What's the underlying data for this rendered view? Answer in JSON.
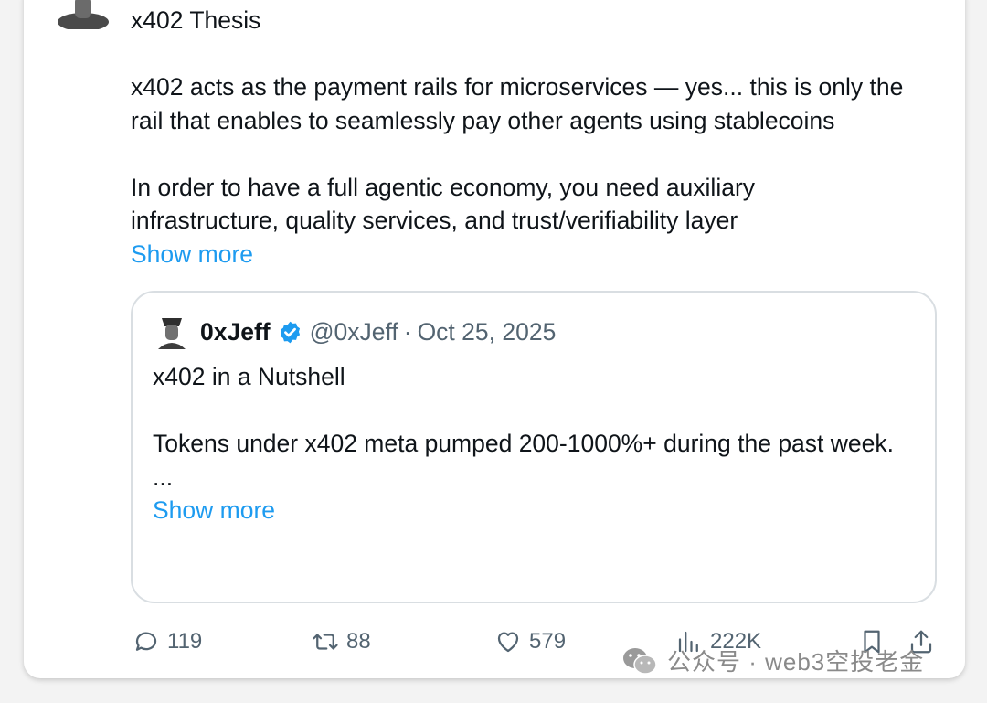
{
  "tweet": {
    "title": "x402 Thesis",
    "para1": "x402 acts as the payment rails for microservices — yes... this is only the rail that enables to seamlessly pay other agents using stablecoins",
    "para2": "In order to have a full agentic economy, you need auxiliary infrastructure, quality services, and trust/verifiability layer",
    "show_more": "Show more"
  },
  "quote": {
    "name": "0xJeff",
    "handle": "@0xJeff",
    "separator": "·",
    "date": "Oct 25, 2025",
    "title": "x402 in a Nutshell",
    "body": "Tokens under x402 meta pumped 200-1000%+ during the past week.",
    "ellipsis": "...",
    "show_more": "Show more",
    "verified_icon": "verified-badge-icon"
  },
  "actions": {
    "replies": "119",
    "reposts": "88",
    "likes": "579",
    "views": "222K"
  },
  "watermark": {
    "text": "公众号 · web3空投老金"
  },
  "colors": {
    "link": "#1d9bf0",
    "verified": "#1d9bf0",
    "muted": "#536471"
  }
}
